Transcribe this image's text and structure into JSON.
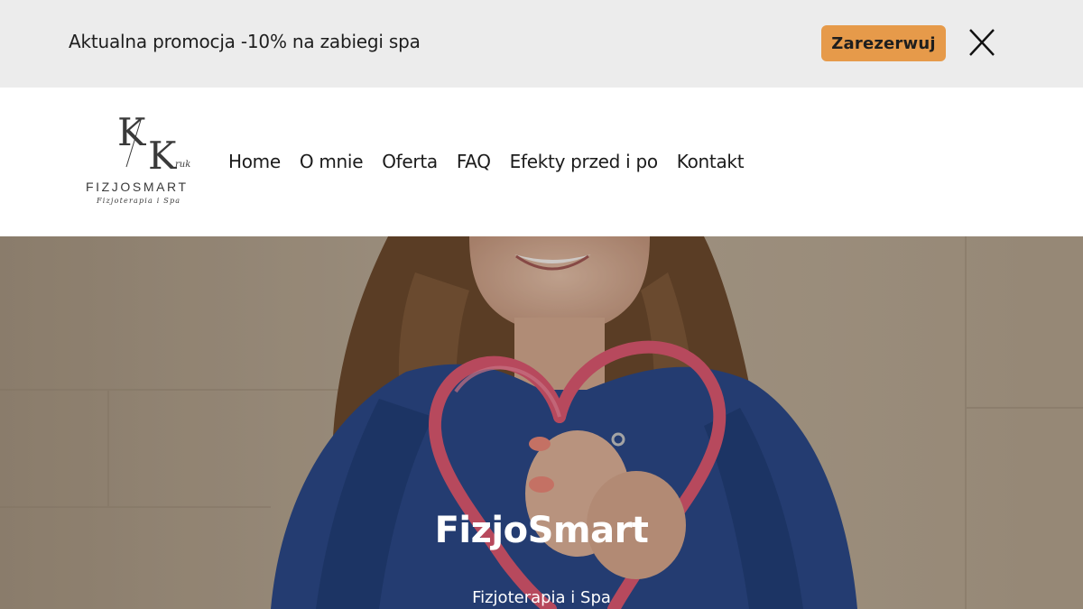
{
  "colors": {
    "promo_bg": "#ececec",
    "button_accent": "#e69a4a",
    "hero_heart": "#e05a72",
    "hero_shirt": "#2c4a8a"
  },
  "promo": {
    "text": "Aktualna promocja -10% na zabiegi spa",
    "button_label": "Zarezerwuj",
    "close_icon": "close-icon"
  },
  "logo": {
    "monogram": "K/K",
    "script": "ruk",
    "name": "FIZJOSMART",
    "tagline": "Fizjoterapia i Spa"
  },
  "nav": {
    "items": [
      {
        "label": "Home"
      },
      {
        "label": "O mnie"
      },
      {
        "label": "Oferta"
      },
      {
        "label": "FAQ"
      },
      {
        "label": "Efekty przed i po"
      },
      {
        "label": "Kontakt"
      }
    ]
  },
  "hero": {
    "title": "FizjoSmart",
    "subtitle": "Fizjoterapia i Spa",
    "image": "woman-holding-heart-shaped-massage-tool"
  }
}
